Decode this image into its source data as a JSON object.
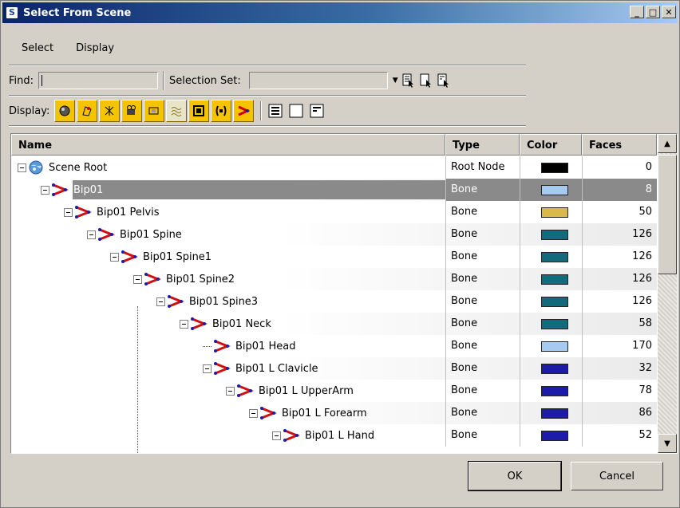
{
  "window": {
    "title": "Select From Scene"
  },
  "menu": [
    "Select",
    "Display"
  ],
  "toolbar": {
    "find_label": "Find:",
    "find_value": "",
    "selection_set_label": "Selection Set:",
    "selection_set_value": "",
    "display_label": "Display:"
  },
  "columns": {
    "name": "Name",
    "type": "Type",
    "color": "Color",
    "faces": "Faces"
  },
  "rows": [
    {
      "name": "Scene Root",
      "type": "Root Node",
      "color": "#000000",
      "faces": "0",
      "depth": 0,
      "icon": "scene-root-icon",
      "selected": false
    },
    {
      "name": "Bip01",
      "type": "Bone",
      "color": "#a6caf0",
      "faces": "8",
      "depth": 1,
      "icon": "bone-icon",
      "selected": true
    },
    {
      "name": "Bip01 Pelvis",
      "type": "Bone",
      "color": "#d8b94a",
      "faces": "50",
      "depth": 2,
      "icon": "bone-icon",
      "selected": false
    },
    {
      "name": "Bip01 Spine",
      "type": "Bone",
      "color": "#116b7a",
      "faces": "126",
      "depth": 3,
      "icon": "bone-icon",
      "selected": false
    },
    {
      "name": "Bip01 Spine1",
      "type": "Bone",
      "color": "#116b7a",
      "faces": "126",
      "depth": 4,
      "icon": "bone-icon",
      "selected": false
    },
    {
      "name": "Bip01 Spine2",
      "type": "Bone",
      "color": "#116b7a",
      "faces": "126",
      "depth": 5,
      "icon": "bone-icon",
      "selected": false
    },
    {
      "name": "Bip01 Spine3",
      "type": "Bone",
      "color": "#116b7a",
      "faces": "126",
      "depth": 6,
      "icon": "bone-icon",
      "selected": false
    },
    {
      "name": "Bip01 Neck",
      "type": "Bone",
      "color": "#116b7a",
      "faces": "58",
      "depth": 7,
      "icon": "bone-icon",
      "selected": false
    },
    {
      "name": "Bip01 Head",
      "type": "Bone",
      "color": "#a6caf0",
      "faces": "170",
      "depth": 8,
      "icon": "bone-icon",
      "selected": false,
      "leaf": true
    },
    {
      "name": "Bip01 L Clavicle",
      "type": "Bone",
      "color": "#1c1ca8",
      "faces": "32",
      "depth": 8,
      "icon": "bone-icon",
      "selected": false
    },
    {
      "name": "Bip01 L UpperArm",
      "type": "Bone",
      "color": "#1c1ca8",
      "faces": "78",
      "depth": 9,
      "icon": "bone-icon",
      "selected": false
    },
    {
      "name": "Bip01 L Forearm",
      "type": "Bone",
      "color": "#1c1ca8",
      "faces": "86",
      "depth": 10,
      "icon": "bone-icon",
      "selected": false
    },
    {
      "name": "Bip01 L Hand",
      "type": "Bone",
      "color": "#1c1ca8",
      "faces": "52",
      "depth": 11,
      "icon": "bone-icon",
      "selected": false
    }
  ],
  "buttons": {
    "ok": "OK",
    "cancel": "Cancel"
  }
}
